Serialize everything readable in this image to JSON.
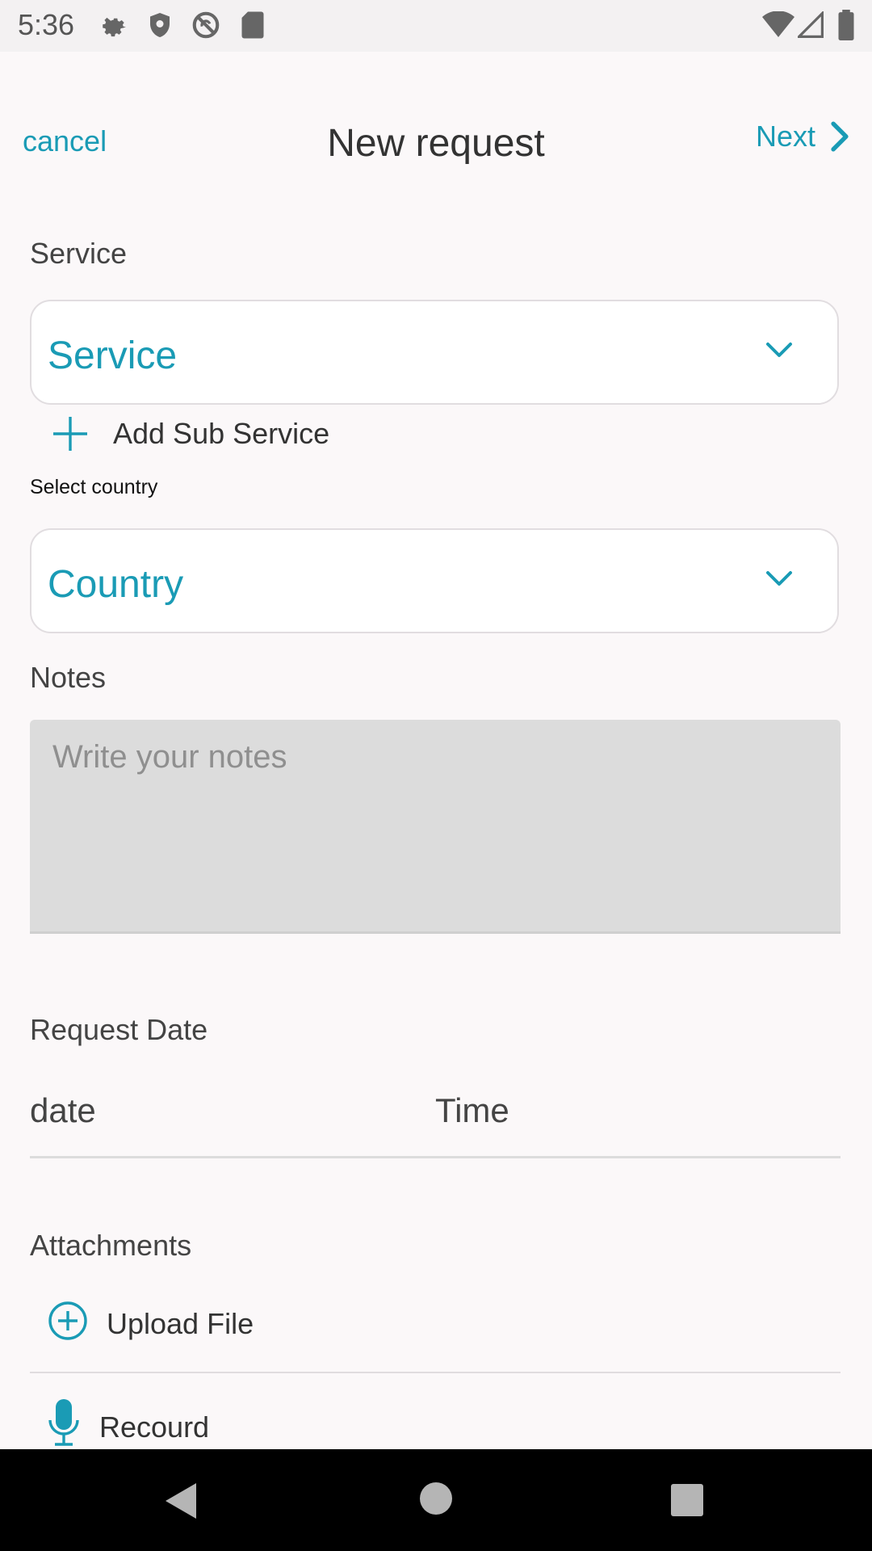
{
  "status_bar": {
    "time": "5:36",
    "left_icons": [
      "gear-icon",
      "shield-icon",
      "no-sync-icon",
      "sd-card-icon"
    ],
    "right_icons": [
      "wifi-icon",
      "signal-icon",
      "battery-icon"
    ]
  },
  "header": {
    "cancel_label": "cancel",
    "title": "New request",
    "next_label": "Next"
  },
  "service": {
    "section_label": "Service",
    "dropdown_value": "Service",
    "add_sub_label": "Add Sub Service"
  },
  "country": {
    "section_label": "Select country",
    "dropdown_value": "Country"
  },
  "notes": {
    "section_label": "Notes",
    "placeholder": "Write your notes"
  },
  "request_date": {
    "section_label": "Request Date",
    "date_placeholder": "date",
    "time_placeholder": "Time"
  },
  "attachments": {
    "section_label": "Attachments",
    "upload_label": "Upload File",
    "record_label": "Recourd"
  },
  "colors": {
    "accent": "#1a9bb5",
    "background": "#fbf8f9",
    "notes_background": "#dcdcdc"
  }
}
